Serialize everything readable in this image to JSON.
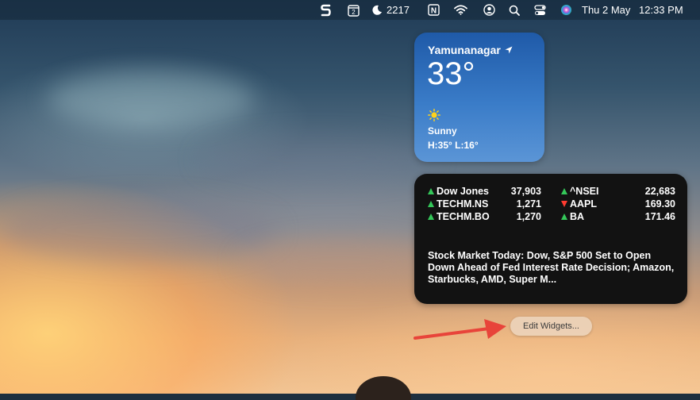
{
  "menubar": {
    "icons": [
      "s-app-icon",
      "calendar-icon",
      "moon-icon",
      "notion-icon",
      "wifi-icon",
      "user-icon",
      "search-icon",
      "control-center-icon",
      "siri-icon"
    ],
    "calendar_badge": "2",
    "moon_count": "2217",
    "notion_letter": "N",
    "date": "Thu 2 May",
    "time": "12:33 PM"
  },
  "weather": {
    "city": "Yamunanagar",
    "temperature": "33°",
    "condition": "Sunny",
    "high_low": "H:35° L:16°",
    "icon": "sun-icon",
    "location_icon": "location-arrow-icon"
  },
  "stocks": {
    "left": [
      {
        "name": "Dow Jones",
        "value": "37,903",
        "direction": "up"
      },
      {
        "name": "TECHM.NS",
        "value": "1,271",
        "direction": "up"
      },
      {
        "name": "TECHM.BO",
        "value": "1,270",
        "direction": "up"
      }
    ],
    "right": [
      {
        "name": "^NSEI",
        "value": "22,683",
        "direction": "up"
      },
      {
        "name": "AAPL",
        "value": "169.30",
        "direction": "down"
      },
      {
        "name": "BA",
        "value": "171.46",
        "direction": "up"
      }
    ],
    "news_headline": "Stock Market Today: Dow, S&P 500 Set to Open Down Ahead of Fed Interest Rate Decision; Amazon, Starbucks, AMD, Super M...",
    "up_color": "#34c759",
    "down_color": "#ff3b30"
  },
  "edit_widgets_label": "Edit Widgets...",
  "annotation_arrow_color": "#e8443a"
}
